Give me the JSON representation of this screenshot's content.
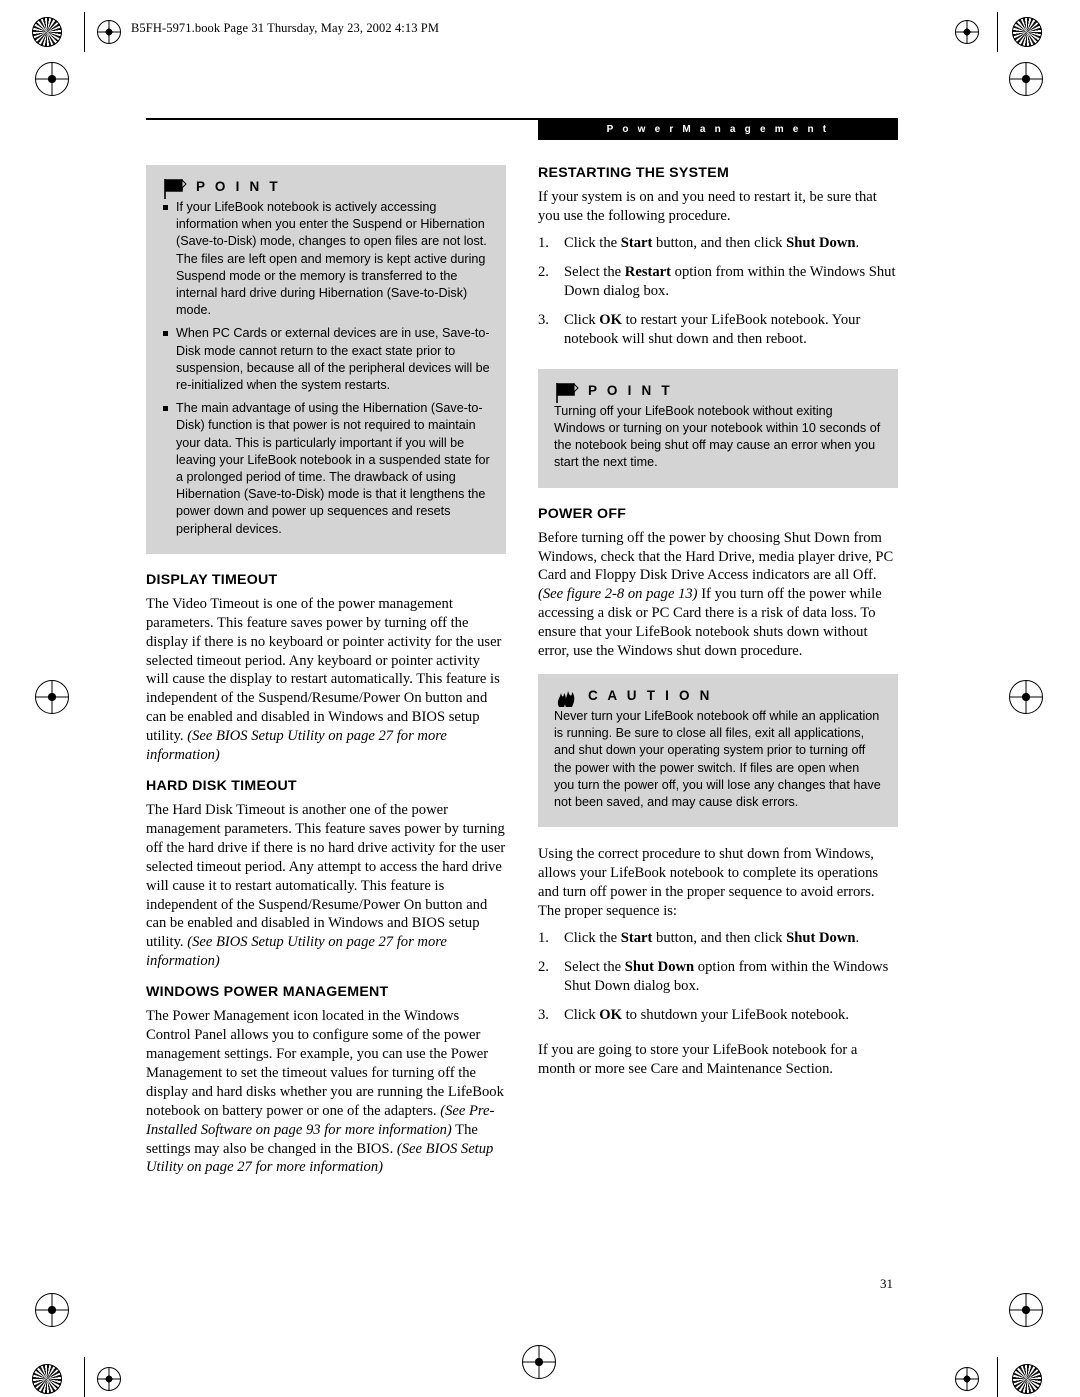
{
  "header": {
    "text": "B5FH-5971.book  Page 31  Thursday, May 23, 2002  4:13 PM"
  },
  "section_tab": {
    "label": "P o w e r   M a n a g e m e n t"
  },
  "page_number": "31",
  "left_column": {
    "point_callout": {
      "title": "P O I N T",
      "icon": "point-flag-icon",
      "bullets": [
        "If your LifeBook notebook is actively accessing information when you enter the Suspend or Hibernation (Save-to-Disk) mode, changes to open files are not lost. The files are left open and memory is kept active during Suspend mode or the memory is transferred to the internal hard drive during Hibernation (Save-to-Disk) mode.",
        "When PC Cards or external devices are in use, Save-to-Disk mode cannot return to the exact state prior to suspension, because all of the peripheral devices will be re-initialized when the system restarts.",
        "The main advantage of using the Hibernation (Save-to-Disk) function is that power is not required to maintain your data. This is particularly important if you will be leaving your LifeBook notebook in a suspended state for a prolonged period of time. The drawback of using Hibernation (Save-to-Disk) mode is that it lengthens the power down and power up sequences and resets peripheral devices."
      ]
    },
    "sections": [
      {
        "heading": "DISPLAY TIMEOUT",
        "paragraphs": [
          {
            "runs": [
              {
                "t": "The Video Timeout is one of the power management parameters. This feature saves power by turning off the display if there is no keyboard or pointer activity for the user selected timeout period. Any keyboard or pointer activity will cause the display to restart automatically. This feature is independent of the Suspend/Resume/Power On button and can be enabled and disabled in Windows and BIOS setup utility. ",
                "s": "n"
              },
              {
                "t": "(See BIOS Setup Utility on page 27 for more information)",
                "s": "i"
              }
            ]
          }
        ]
      },
      {
        "heading": "HARD DISK TIMEOUT",
        "paragraphs": [
          {
            "runs": [
              {
                "t": "The Hard Disk Timeout is another one of the power management parameters. This feature saves power by turning off the hard drive if there is no hard drive activity for the user selected timeout period. Any attempt to access the hard drive will cause it to restart automatically. This feature is independent of the Suspend/Resume/Power On button and can be enabled and disabled in Windows and BIOS setup utility. ",
                "s": "n"
              },
              {
                "t": "(See BIOS Setup Utility on page 27 for more information)",
                "s": "i"
              }
            ]
          }
        ]
      },
      {
        "heading": "WINDOWS POWER MANAGEMENT",
        "paragraphs": [
          {
            "runs": [
              {
                "t": "The Power Management icon located in the Windows Control Panel allows you to configure some of the power management settings. For example, you can use the Power Management to set the timeout values for turning off the display and hard disks whether you are running the LifeBook notebook on battery power or one of the adapters. ",
                "s": "n"
              },
              {
                "t": "(See Pre-Installed Software on page 93 for more information)",
                "s": "i"
              },
              {
                "t": " The settings may also be changed in the BIOS. ",
                "s": "n"
              },
              {
                "t": "(See BIOS Setup Utility on page 27 for more information)",
                "s": "i"
              }
            ]
          }
        ]
      }
    ]
  },
  "right_column": {
    "sections": [
      {
        "heading": "RESTARTING THE SYSTEM",
        "intro": "If your system is on and you need to restart it, be sure that you use the following procedure.",
        "steps": [
          [
            {
              "t": "Click the ",
              "s": "n"
            },
            {
              "t": "Start",
              "s": "b"
            },
            {
              "t": " button, and then click ",
              "s": "n"
            },
            {
              "t": "Shut Down",
              "s": "b"
            },
            {
              "t": ".",
              "s": "n"
            }
          ],
          [
            {
              "t": "Select the ",
              "s": "n"
            },
            {
              "t": "Restart",
              "s": "b"
            },
            {
              "t": " option from within the Windows Shut Down dialog box.",
              "s": "n"
            }
          ],
          [
            {
              "t": "Click ",
              "s": "n"
            },
            {
              "t": "OK",
              "s": "b"
            },
            {
              "t": " to restart your LifeBook notebook. Your notebook will shut down and then reboot.",
              "s": "n"
            }
          ]
        ]
      }
    ],
    "point_callout": {
      "title": "P O I N T",
      "icon": "point-flag-icon",
      "text": "Turning off your LifeBook notebook without exiting Windows or turning on your notebook within 10 seconds of the notebook being shut off may cause an error when you start the next time."
    },
    "power_off": {
      "heading": "POWER OFF",
      "paragraph_runs": [
        {
          "t": "Before turning off the power by choosing Shut Down from Windows, check that the Hard Drive, media player drive, PC Card and Floppy Disk Drive Access indicators are all Off. ",
          "s": "n"
        },
        {
          "t": "(See figure 2-8 on page 13)",
          "s": "i"
        },
        {
          "t": " If you turn off the power while accessing a disk or PC Card there is a risk of data loss. To ensure that your LifeBook notebook shuts down without error, use the Windows shut down procedure.",
          "s": "n"
        }
      ]
    },
    "caution_callout": {
      "title": "C A U T I O N",
      "icon": "caution-flame-icon",
      "text": "Never turn your LifeBook notebook off while an application is running. Be sure to close all files, exit all applications, and shut down your operating system prior to turning off the power with the power switch. If files are open when you turn the power off, you will lose any changes that have not been saved, and may cause disk errors."
    },
    "closing": {
      "paragraph": "Using the correct procedure to shut down from Windows, allows your LifeBook notebook to complete its operations and turn off power in the proper sequence to avoid errors. The proper sequence is:",
      "steps": [
        [
          {
            "t": "Click the ",
            "s": "n"
          },
          {
            "t": "Start",
            "s": "b"
          },
          {
            "t": " button, and then click ",
            "s": "n"
          },
          {
            "t": "Shut Down",
            "s": "b"
          },
          {
            "t": ".",
            "s": "n"
          }
        ],
        [
          {
            "t": "Select the ",
            "s": "n"
          },
          {
            "t": "Shut Down",
            "s": "b"
          },
          {
            "t": " option from within the Windows Shut Down dialog box.",
            "s": "n"
          }
        ],
        [
          {
            "t": "Click ",
            "s": "n"
          },
          {
            "t": "OK",
            "s": "b"
          },
          {
            "t": " to shutdown your LifeBook notebook.",
            "s": "n"
          }
        ]
      ],
      "final": "If you are going to store your LifeBook notebook for a month or more see Care and Maintenance Section."
    }
  }
}
